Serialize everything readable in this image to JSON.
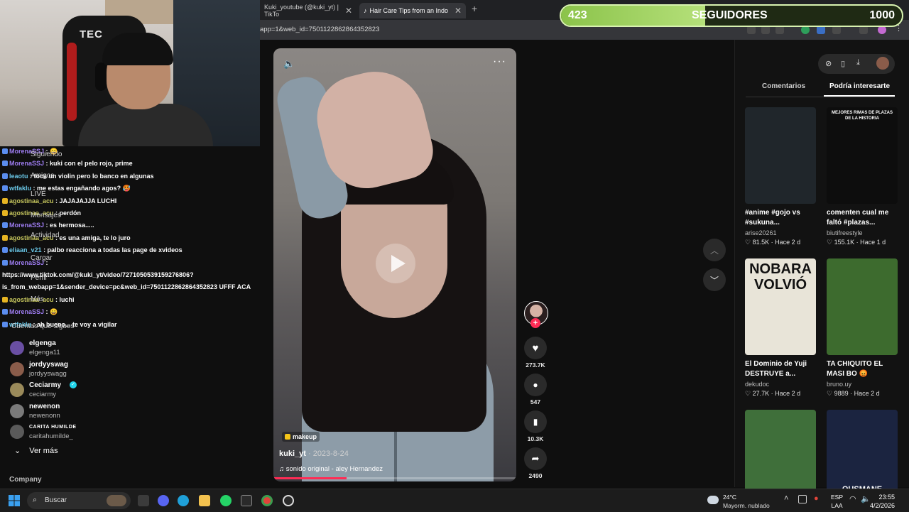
{
  "browser": {
    "tabs": [
      {
        "title": "Kuki_youtube (@kuki_yt) | TikTo"
      },
      {
        "title": "Hair Care Tips from an Indo"
      }
    ],
    "url": "app=1&web_id=7501122862864352823"
  },
  "overlay": {
    "followers_current": "423",
    "followers_label": "SEGUIDORES",
    "followers_goal": "1000",
    "progress_fraction": 0.423
  },
  "sidebar_ghost": [
    "Siguiendo",
    "Amigos",
    "LIVE",
    "Mensajes",
    "Actividad",
    "Cargar",
    "Perfil",
    "Más",
    "Cuentas que sigues"
  ],
  "chat": [
    {
      "user": "MorenaSSJ",
      "msg": ": 😀",
      "color": "purple"
    },
    {
      "user": "MorenaSSJ",
      "msg": ": kuki con el pelo rojo, prime",
      "color": "purple"
    },
    {
      "user": "leaotu",
      "msg": ": toca un violin pero lo banco en algunas",
      "color": "blue"
    },
    {
      "user": "wtfaklu",
      "msg": ": me estas engañando agos? 🥵",
      "color": "blue"
    },
    {
      "user": "agostinaa_acu",
      "msg": ": JAJAJAJJA LUCHI",
      "color": "yellow"
    },
    {
      "user": "agostinaa_acu",
      "msg": ": perdón",
      "color": "yellow"
    },
    {
      "user": "MorenaSSJ",
      "msg": ": es hermosa.....",
      "color": "purple"
    },
    {
      "user": "agostinaa_acu",
      "msg": ": es una amiga, te lo juro",
      "color": "yellow"
    },
    {
      "user": "eliaan_v21",
      "msg": ": palbo reacciona a todas las page de xvideos",
      "color": "blue"
    },
    {
      "user": "MorenaSSJ",
      "msg": ":",
      "color": "purple"
    },
    {
      "user": "",
      "msg": "https://www.tiktok.com/@kuki_yt/video/7271050539159276806?",
      "color": "none"
    },
    {
      "user": "",
      "msg": "is_from_webapp=1&sender_device=pc&web_id=7501122862864352823 UFFF ACA",
      "color": "none"
    },
    {
      "user": "agostinaa_acu",
      "msg": ": luchi",
      "color": "yellow"
    },
    {
      "user": "MorenaSSJ",
      "msg": ": 😀",
      "color": "purple"
    },
    {
      "user": "wtfaklu",
      "msg": ": ah bueno... te voy a vigilar",
      "color": "blue"
    },
    {
      "user": "eliaan_v21",
      "msg": ": tu amigo lu",
      "color": "blue"
    }
  ],
  "following": [
    {
      "name": "elgenga",
      "handle": "elgenga11",
      "color": "#6a4fa3"
    },
    {
      "name": "jordyyswag",
      "handle": "jordyyswagg",
      "color": "#8a5c4a"
    },
    {
      "name": "Ceciarmy",
      "handle": "ceciarmy",
      "color": "#9a8a5a"
    },
    {
      "name": "newenon",
      "handle": "newenonn",
      "color": "#7a7a7a"
    },
    {
      "name": "CARITA HUMILDE",
      "handle": "caritahumilde_",
      "color": "#5a5a5a"
    }
  ],
  "see_more": "Ver más",
  "company": "Company",
  "video": {
    "tag": "makeup",
    "author": "kuki_yt",
    "date": " · 2023-8-24",
    "sound": "♫  sonido original - aley Hernandez",
    "likes": "273.7K",
    "comments": "547",
    "saves": "10.3K",
    "shares": "2490",
    "progress_fraction": 0.3
  },
  "right_panel": {
    "tab_comments": "Comentarios",
    "tab_interesting": "Podría interesarte",
    "cards": [
      {
        "title": "#anime #gojo vs #sukuna...",
        "author": "arise20261",
        "likes": "81.5K",
        "age": "Hace 2 d",
        "thumb_text": "",
        "bg": "#20262b"
      },
      {
        "title": "comenten cual me faltó #plazas...",
        "author": "biutifreestyle",
        "likes": "155.1K",
        "age": "Hace 1 d",
        "thumb_text": "MEJORES RIMAS DE PLAZAS DE LA HISTORIA",
        "bg": "#0d0d0d"
      },
      {
        "title": "El Dominio de Yuji DESTRUYE a...",
        "author": "dekudoc",
        "likes": "27.7K",
        "age": "Hace 2 d",
        "thumb_text": "NOBARA VOLVIÓ",
        "bg": "#e8e4d8"
      },
      {
        "title": "TA CHIQUITO EL MASI BO 😡",
        "author": "bruno.uy",
        "likes": "9889",
        "age": "Hace 2 d",
        "thumb_text": "",
        "bg": "#3d6b2e"
      },
      {
        "title": "",
        "author": "",
        "likes": "",
        "age": "",
        "thumb_text": "",
        "bg": "#3f6f3a"
      },
      {
        "title": "",
        "author": "",
        "likes": "",
        "age": "",
        "thumb_text": "OUSMANE DEMBELE",
        "bg": "#1b2440"
      }
    ]
  },
  "taskbar": {
    "search_placeholder": "Buscar",
    "weather_temp": "24°C",
    "weather_desc": "Mayorm. nublado",
    "lang_1": "ESP",
    "lang_2": "LAA",
    "time": "23:55",
    "date": "4/2/2026"
  }
}
